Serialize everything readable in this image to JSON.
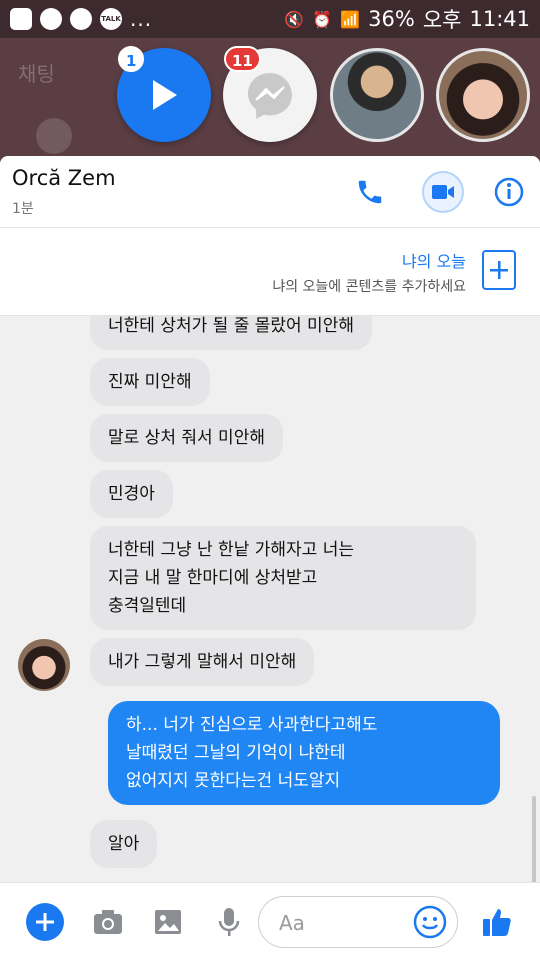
{
  "status_bar": {
    "dots": "...",
    "battery": "36%",
    "ampm": "오후",
    "time": "11:41",
    "talk_label": "TALK"
  },
  "chat_heads": {
    "background_label": "채팅",
    "badge_play": "1",
    "badge_messenger": "11"
  },
  "header": {
    "contact_name": "Orcă Zem",
    "subtitle": "1분"
  },
  "my_day": {
    "title": "냐의 오늘",
    "subtitle": "냐의 오늘에 콘텐츠를 추가하세요"
  },
  "messages": [
    {
      "text": "너한테 상처가 될 줄 몰랐어 미안해",
      "direction": "in"
    },
    {
      "text": "진짜 미안해",
      "direction": "in"
    },
    {
      "text": "말로 상처 줘서 미안해",
      "direction": "in"
    },
    {
      "text": "민경아",
      "direction": "in"
    },
    {
      "line1": "너한테 그냥 난 한낱 가해자고 너는",
      "line2": "지금 내 말 한마디에 상처받고",
      "line3": "충격일텐데",
      "direction": "in"
    },
    {
      "text": "내가 그렇게 말해서 미안해",
      "direction": "in"
    },
    {
      "line1": "하... 너가 진심으로 사과한다고해도",
      "line2": "날때렸던 그날의 기억이 냐한테",
      "line3": "없어지지 못한다는건 너도알지",
      "direction": "out"
    },
    {
      "text": "알아",
      "direction": "in"
    }
  ],
  "composer": {
    "placeholder": "Aa"
  },
  "colors": {
    "accent": "#1a79f1",
    "outgoing_bubble": "#1f86f4",
    "incoming_bubble": "#e5e5e8",
    "badge_red": "#e53935"
  }
}
